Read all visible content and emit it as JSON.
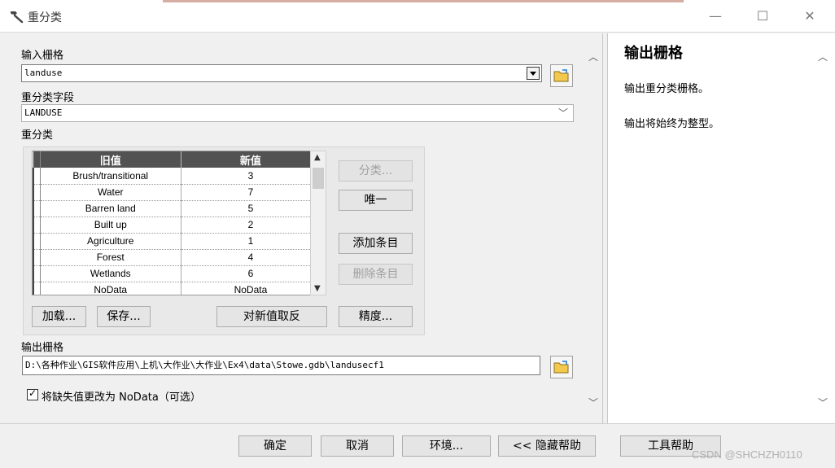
{
  "window": {
    "title": "重分类",
    "minimize_glyph": "—",
    "maximize_glyph": "☐",
    "close_glyph": "✕"
  },
  "form": {
    "input_raster_label": "输入栅格",
    "input_raster_value": "landuse",
    "reclass_field_label": "重分类字段",
    "reclass_field_value": "LANDUSE",
    "reclass_label": "重分类",
    "table": {
      "headers": [
        "旧值",
        "新值"
      ],
      "rows": [
        {
          "old": "Brush/transitional",
          "new": "3"
        },
        {
          "old": "Water",
          "new": "7"
        },
        {
          "old": "Barren land",
          "new": "5"
        },
        {
          "old": "Built up",
          "new": "2"
        },
        {
          "old": "Agriculture",
          "new": "1"
        },
        {
          "old": "Forest",
          "new": "4"
        },
        {
          "old": "Wetlands",
          "new": "6"
        },
        {
          "old": "NoData",
          "new": "NoData"
        }
      ]
    },
    "buttons": {
      "classify": "分类...",
      "unique": "唯一",
      "add_entry": "添加条目",
      "delete_entry": "删除条目",
      "load": "加载...",
      "save": "保存...",
      "reverse": "对新值取反",
      "precision": "精度..."
    },
    "output_raster_label": "输出栅格",
    "output_raster_value": "D:\\各种作业\\GIS软件应用\\上机\\大作业\\大作业\\Ex4\\data\\Stowe.gdb\\landusecf1",
    "checkbox_label": "将缺失值更改为 NoData（可选）",
    "checkbox_checked": true
  },
  "help": {
    "title": "输出栅格",
    "p1": "输出重分类栅格。",
    "p2": "输出将始终为整型。"
  },
  "footer": {
    "ok": "确定",
    "cancel": "取消",
    "environments": "环境...",
    "hide_help": "<< 隐藏帮助",
    "tool_help": "工具帮助"
  },
  "watermark": "CSDN @SHCHZH0110"
}
